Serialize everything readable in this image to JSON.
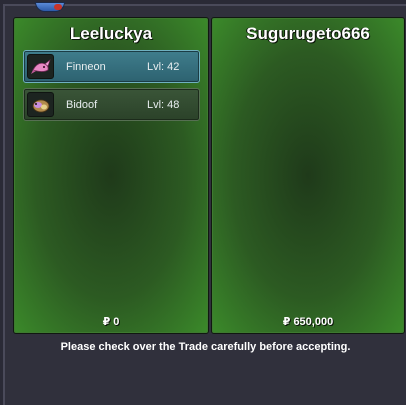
{
  "left_panel": {
    "trainer_name": "Leeluckya",
    "money_symbol": "₽",
    "money": "0",
    "pokemon": [
      {
        "name": "Finneon",
        "level": "Lvl: 42",
        "icon": "finneon-icon",
        "selected": true
      },
      {
        "name": "Bidoof",
        "level": "Lvl: 48",
        "icon": "bidoof-icon",
        "selected": false
      }
    ]
  },
  "right_panel": {
    "trainer_name": "Sugurugeto666",
    "money_symbol": "₽",
    "money": "650,000",
    "pokemon": []
  },
  "footer": {
    "message": "Please check over the Trade carefully before accepting."
  }
}
